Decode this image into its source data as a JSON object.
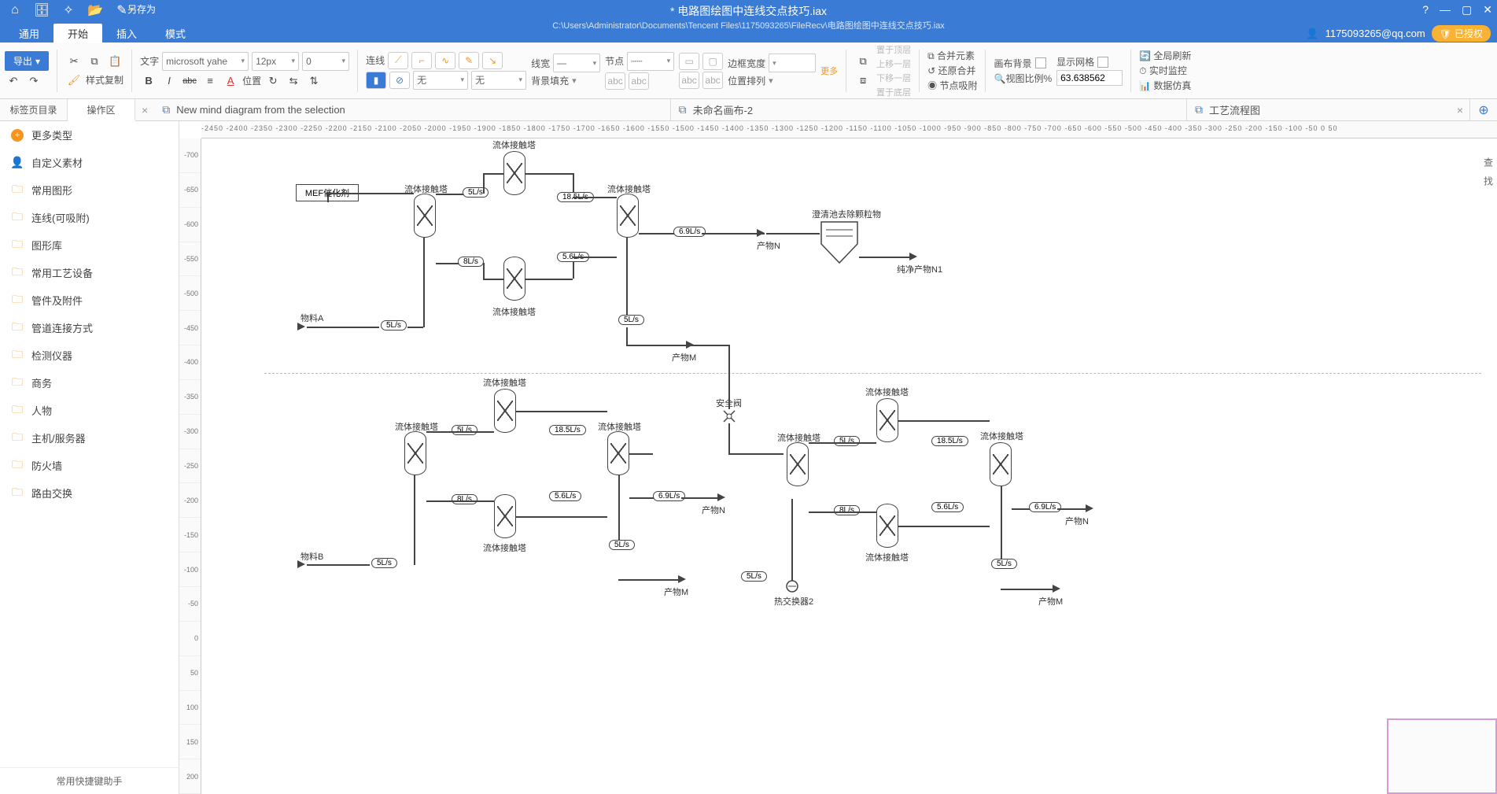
{
  "titlebar": {
    "saveas": "另存为",
    "title": "* 电路图绘图中连线交点技巧.iax",
    "subtitle": "C:\\Users\\Administrator\\Documents\\Tencent Files\\1175093265\\FileRecv\\电路图绘图中连线交点技巧.iax",
    "help": "?",
    "min": "—",
    "max": "▢",
    "close": "✕",
    "user": "1175093265@qq.com",
    "auth": "已授权"
  },
  "menus": {
    "m0": "通用",
    "m1": "开始",
    "m2": "插入",
    "m3": "模式"
  },
  "ribbon": {
    "export": "导出",
    "undo": "↶",
    "redo": "↷",
    "fmtpaint": "样式复制",
    "text_lbl": "文字",
    "font": "microsoft yahe",
    "fontsize": "12px",
    "opacity": "0",
    "bold": "B",
    "italic": "I",
    "strike": "abc",
    "align": "≡",
    "fontcolor": "A",
    "pos": "位置",
    "rot": "↻",
    "fliph": "⇆",
    "flipv": "⇅",
    "line_lbl": "连线",
    "linew_lbl": "线宽",
    "node_lbl": "节点",
    "fill_none1": "无",
    "fill_none2": "无",
    "bgfill": "背景填充",
    "edgedist": "边框宽度",
    "more": "更多",
    "poslist": "位置排列",
    "arr_top": "置于顶层",
    "arr_up": "上移一层",
    "arr_dn": "下移一层",
    "arr_bot": "置于底层",
    "merge": "合并元素",
    "unmerge": "还原合并",
    "nodesnap": "节点吸附",
    "canvasbg": "画布背景",
    "showgrid": "显示网格",
    "viewpct_lbl": "视图比例%",
    "viewpct": "63.638562",
    "refresh": "全局刷新",
    "monitor": "实时监控",
    "sim": "数据仿真"
  },
  "sidetabs": {
    "t0": "标签页目录",
    "t1": "操作区"
  },
  "doctabs": {
    "d0": "New mind diagram from the selection",
    "d1": "未命名画布-2",
    "d2": "工艺流程图"
  },
  "sidebar": {
    "items": [
      {
        "icon": "plus",
        "label": "更多类型"
      },
      {
        "icon": "user",
        "label": "自定义素材"
      },
      {
        "icon": "folder",
        "label": "常用图形"
      },
      {
        "icon": "folder",
        "label": "连线(可吸附)"
      },
      {
        "icon": "folder",
        "label": "图形库"
      },
      {
        "icon": "folder",
        "label": "常用工艺设备"
      },
      {
        "icon": "folder",
        "label": "管件及附件"
      },
      {
        "icon": "folder",
        "label": "管道连接方式"
      },
      {
        "icon": "folder",
        "label": "检测仪器"
      },
      {
        "icon": "folder",
        "label": "商务"
      },
      {
        "icon": "folder",
        "label": "人物"
      },
      {
        "icon": "folder",
        "label": "主机/服务器"
      },
      {
        "icon": "folder",
        "label": "防火墙"
      },
      {
        "icon": "folder",
        "label": "路由交换"
      }
    ],
    "foot": "常用快捷键助手"
  },
  "ruler_h": "-2450 -2400 -2350 -2300 -2250 -2200 -2150 -2100 -2050 -2000 -1950 -1900 -1850 -1800 -1750 -1700 -1650 -1600 -1550 -1500 -1450 -1400 -1350 -1300 -1250 -1200 -1150 -1100 -1050 -1000 -950 -900 -850 -800 -750 -700 -650 -600 -550 -500 -450 -400 -350 -300 -250 -200 -150 -100 -50 0 50",
  "ruler_v": [
    "-700",
    "-650",
    "-600",
    "-550",
    "-500",
    "-450",
    "-400",
    "-350",
    "-300",
    "-250",
    "-200",
    "-150",
    "-100",
    "-50",
    "0",
    "50",
    "100",
    "150",
    "200"
  ],
  "rside": {
    "a": "查",
    "b": "找"
  },
  "diagram": {
    "labels": {
      "mef": "MEF催化剂",
      "contact": "流体接触塔",
      "matA": "物料A",
      "matB": "物料B",
      "prodN": "产物N",
      "prodM": "产物M",
      "prodN1": "纯净产物N1",
      "clarifier": "澄清池去除颗粒物",
      "safety": "安全阀",
      "hex2": "热交换器2"
    },
    "flows": {
      "f5": "5L/s",
      "f8": "8L/s",
      "f185": "18.5L/s",
      "f56": "5.6L/s",
      "f69": "6.9L/s"
    }
  }
}
